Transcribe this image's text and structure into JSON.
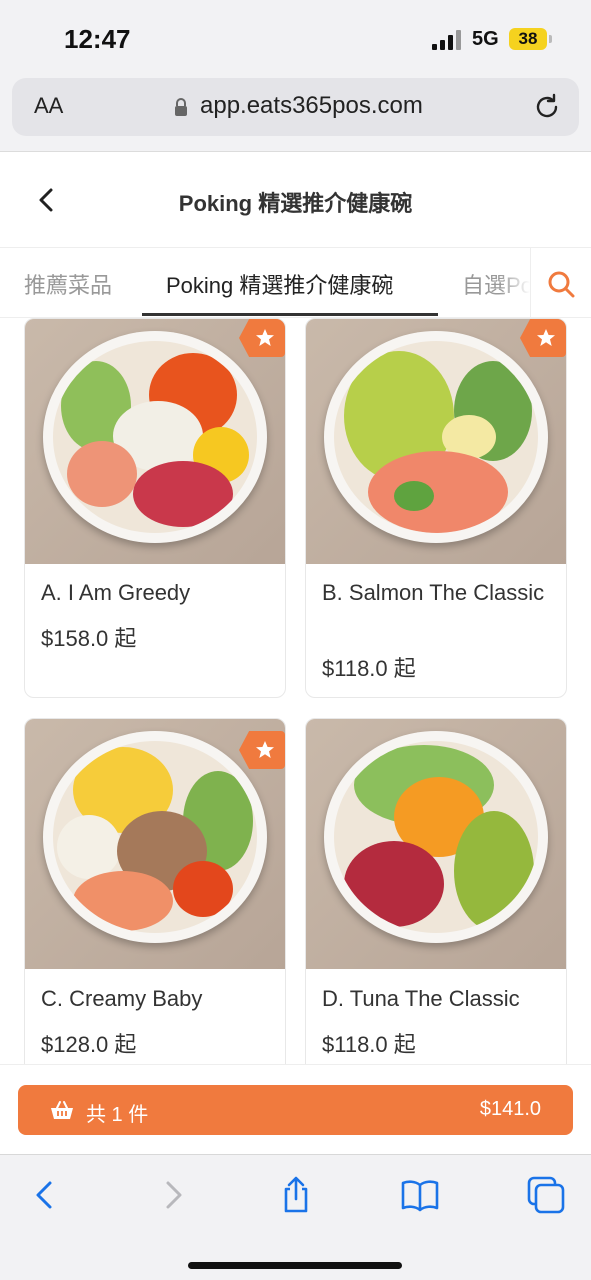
{
  "status": {
    "time": "12:47",
    "network": "5G",
    "battery": "38"
  },
  "browser": {
    "text_size_label": "AA",
    "url": "app.eats365pos.com"
  },
  "header": {
    "title": "Poking 精選推介健康碗"
  },
  "tabs": [
    {
      "label": "推薦菜品",
      "active": false
    },
    {
      "label": "Poking 精選推介健康碗",
      "active": true
    },
    {
      "label": "自選Po",
      "active": false
    }
  ],
  "products": [
    {
      "name": "A. I Am Greedy",
      "price": "$158.0 起",
      "recommended": true
    },
    {
      "name": "B. Salmon The Classic",
      "price": "$118.0 起",
      "recommended": true
    },
    {
      "name": "C. Creamy Baby",
      "price": "$128.0 起",
      "recommended": true
    },
    {
      "name": "D. Tuna The Classic",
      "price": "$118.0 起",
      "recommended": false
    }
  ],
  "cart": {
    "count_label": "共 1 件",
    "total": "$141.0"
  },
  "colors": {
    "accent": "#f07a3e",
    "browser_blue": "#1a73e8"
  },
  "icons": [
    "back-chevron-icon",
    "search-icon",
    "star-icon",
    "basket-icon",
    "lock-icon",
    "reload-icon",
    "share-icon",
    "bookmarks-icon",
    "tabs-icon"
  ]
}
